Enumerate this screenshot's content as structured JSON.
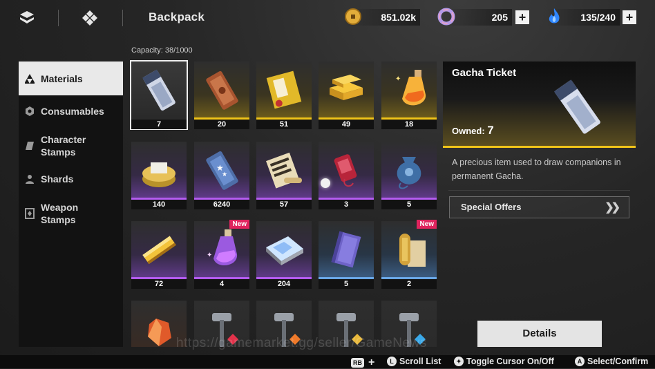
{
  "header": {
    "title": "Backpack",
    "menu_icon": "hex-cluster-icon",
    "nav_icon": "diamond-cluster-icon",
    "currencies": [
      {
        "icon": "gold-coin-icon",
        "value": "851.02k",
        "color": "#e8b43c"
      },
      {
        "icon": "purple-ring-icon",
        "value": "205",
        "color": "#b497e8"
      },
      {
        "icon": "blue-flame-icon",
        "value": "135/240",
        "color": "#3a8fff"
      }
    ],
    "plus_label": "+"
  },
  "capacity": "Capacity: 38/1000",
  "sidebar": {
    "items": [
      {
        "label": "Materials",
        "icon": "triangles-icon",
        "active": true
      },
      {
        "label": "Consumables",
        "icon": "hexagon-icon"
      },
      {
        "label": "Character\nStamps",
        "icon": "tag-icon"
      },
      {
        "label": "Shards",
        "icon": "person-icon"
      },
      {
        "label": "Weapon\nStamps",
        "icon": "card-icon"
      }
    ]
  },
  "items": [
    {
      "name": "gacha-ticket-silver",
      "count": "7",
      "rarity": "plain",
      "selected": true
    },
    {
      "name": "bronze-ticket",
      "count": "20",
      "rarity": "gold"
    },
    {
      "name": "golden-envelope",
      "count": "51",
      "rarity": "gold"
    },
    {
      "name": "gold-ingots",
      "count": "49",
      "rarity": "gold"
    },
    {
      "name": "golden-potion",
      "count": "18",
      "rarity": "gold"
    },
    {
      "name": "coin-stack",
      "count": "140",
      "rarity": "purple"
    },
    {
      "name": "star-ticket",
      "count": "6240",
      "rarity": "purple"
    },
    {
      "name": "scroll-bundle",
      "count": "57",
      "rarity": "purple"
    },
    {
      "name": "red-charm",
      "count": "3",
      "rarity": "purple"
    },
    {
      "name": "blue-pouch",
      "count": "5",
      "rarity": "purple"
    },
    {
      "name": "gold-bar",
      "count": "72",
      "rarity": "purple"
    },
    {
      "name": "purple-potion",
      "count": "4",
      "rarity": "purple",
      "badge": "New"
    },
    {
      "name": "crystal-map",
      "count": "204",
      "rarity": "purple"
    },
    {
      "name": "purple-book",
      "count": "5",
      "rarity": "blue"
    },
    {
      "name": "ancient-scroll",
      "count": "2",
      "rarity": "blue",
      "badge": "New"
    },
    {
      "name": "fire-crystal",
      "count": "",
      "rarity": "plain"
    },
    {
      "name": "hammer-red",
      "count": "",
      "rarity": "plain"
    },
    {
      "name": "hammer-orange",
      "count": "",
      "rarity": "plain"
    },
    {
      "name": "hammer-gold",
      "count": "",
      "rarity": "plain"
    },
    {
      "name": "hammer-blue",
      "count": "",
      "rarity": "plain"
    }
  ],
  "detail": {
    "title": "Gacha Ticket",
    "owned_label": "Owned:",
    "owned_value": "7",
    "description": "A precious item used to draw companions in permanent Gacha.",
    "special_offers": "Special Offers",
    "details_button": "Details"
  },
  "hints": [
    {
      "glyph": "RB",
      "extra": "+",
      "label": ""
    },
    {
      "glyph": "L",
      "label": "Scroll List"
    },
    {
      "glyph": "✦",
      "label": "Toggle Cursor On/Off"
    },
    {
      "glyph": "A",
      "label": "Select/Confirm"
    }
  ],
  "watermark": "https://gamemarket.gg/seller/GameNews"
}
